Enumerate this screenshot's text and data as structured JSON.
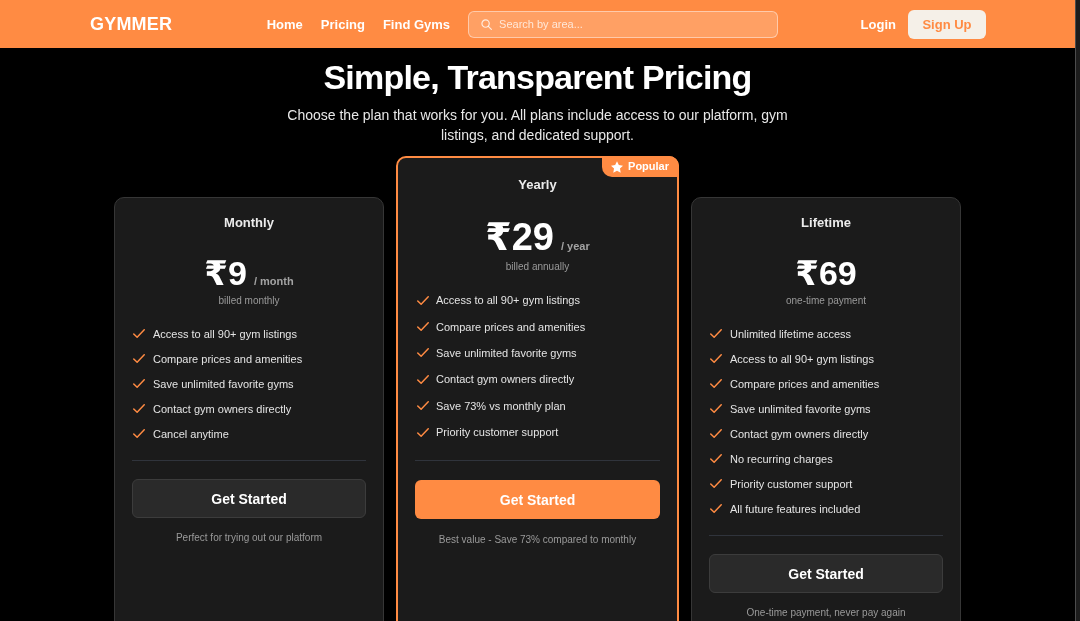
{
  "header": {
    "logo": "GYMMER",
    "nav": [
      {
        "label": "Home"
      },
      {
        "label": "Pricing"
      },
      {
        "label": "Find Gyms"
      }
    ],
    "search": {
      "placeholder": "Search by area..."
    },
    "login": "Login",
    "signup": "Sign Up"
  },
  "hero": {
    "title": "Simple, Transparent Pricing",
    "subtitle": "Choose the plan that works for you. All plans include access to our platform, gym listings, and dedicated support."
  },
  "plans": [
    {
      "name": "Monthly",
      "price": "₹9",
      "period": "/ month",
      "billing": "billed monthly",
      "featured": false,
      "features": [
        "Access to all 90+ gym listings",
        "Compare prices and amenities",
        "Save unlimited favorite gyms",
        "Contact gym owners directly",
        "Cancel anytime"
      ],
      "button": "Get Started",
      "note": "Perfect for trying out our platform"
    },
    {
      "name": "Yearly",
      "price": "₹29",
      "period": "/ year",
      "billing": "billed annually",
      "featured": true,
      "badge": "Popular",
      "features": [
        "Access to all 90+ gym listings",
        "Compare prices and amenities",
        "Save unlimited favorite gyms",
        "Contact gym owners directly",
        "Save 73% vs monthly plan",
        "Priority customer support"
      ],
      "button": "Get Started",
      "note": "Best value - Save 73% compared to monthly"
    },
    {
      "name": "Lifetime",
      "price": "₹69",
      "billing": "one-time payment",
      "featured": false,
      "features": [
        "Unlimited lifetime access",
        "Access to all 90+ gym listings",
        "Compare prices and amenities",
        "Save unlimited favorite gyms",
        "Contact gym owners directly",
        "No recurring charges",
        "Priority customer support",
        "All future features included"
      ],
      "button": "Get Started",
      "note": "One-time payment, never pay again"
    }
  ]
}
